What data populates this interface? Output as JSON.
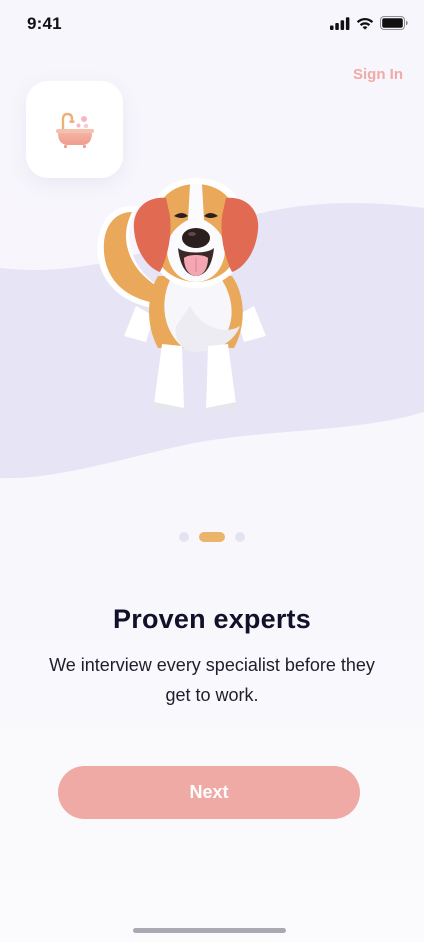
{
  "status_bar": {
    "time": "9:41",
    "icons": [
      "cellular-signal-icon",
      "wifi-icon",
      "battery-icon"
    ]
  },
  "header": {
    "sign_in_label": "Sign In"
  },
  "logo": {
    "icon": "bathtub-icon"
  },
  "illustration": {
    "subject": "beagle-dog-illustration"
  },
  "pager": {
    "total": 3,
    "active_index": 1
  },
  "content": {
    "title": "Proven experts",
    "subtitle": "We interview every specialist before they get to work."
  },
  "actions": {
    "next_label": "Next"
  },
  "colors": {
    "accent": "#f0aaa6",
    "pager_active": "#eab56b",
    "pager_inactive": "#e5e3f1",
    "wave": "#e6e4f5",
    "title": "#11122a"
  }
}
